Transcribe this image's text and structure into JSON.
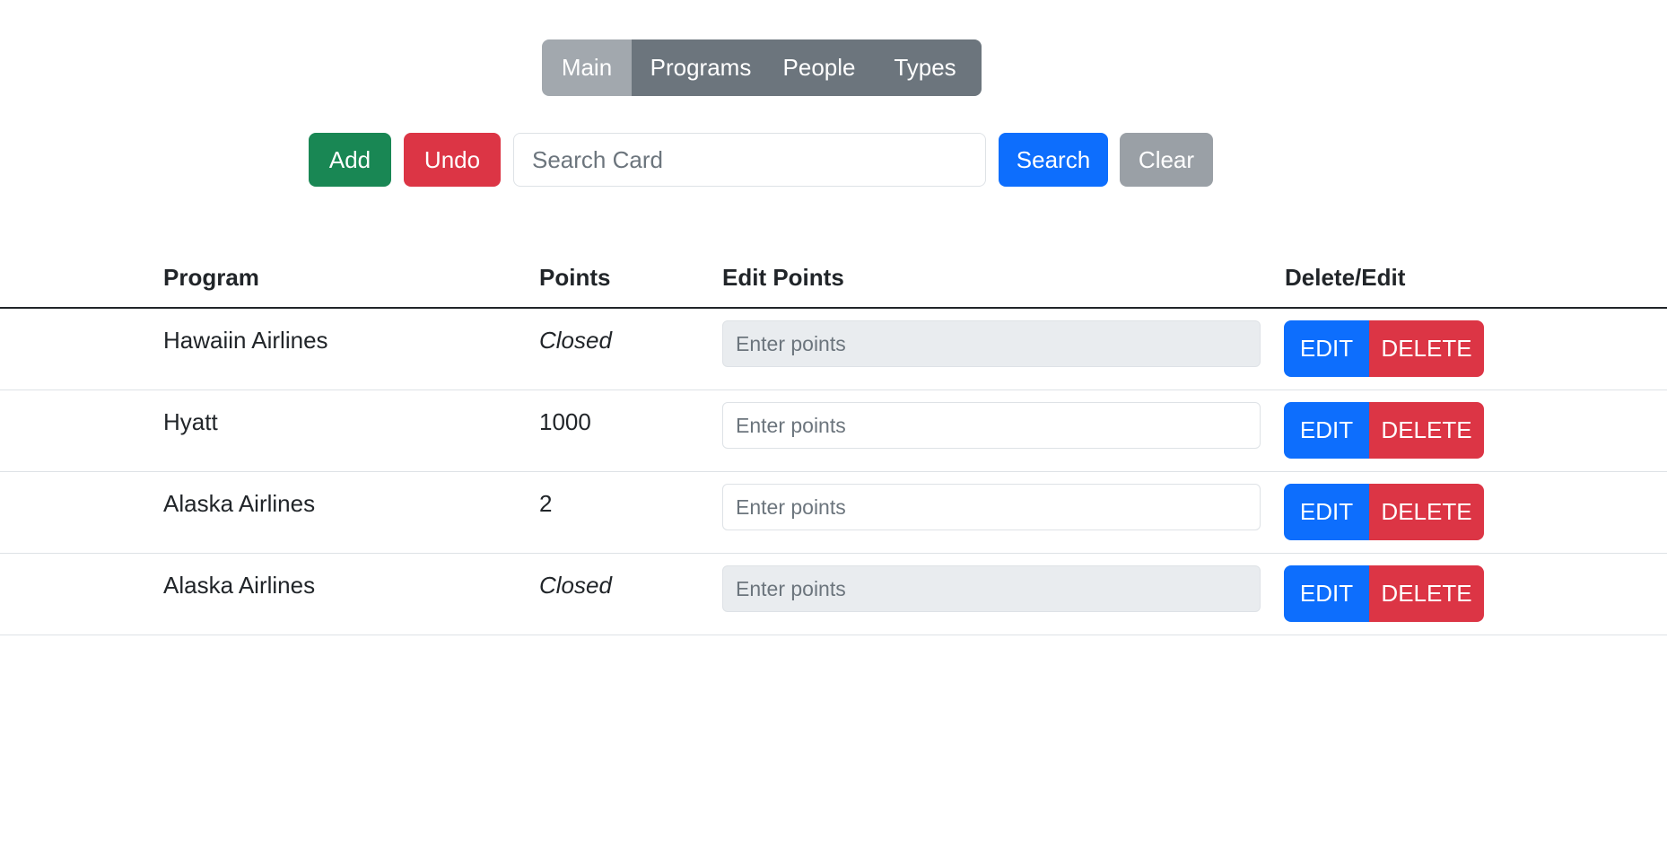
{
  "nav": {
    "tabs": [
      {
        "label": "Main",
        "active": true
      },
      {
        "label": "Programs",
        "active": false
      },
      {
        "label": "People",
        "active": false
      },
      {
        "label": "Types",
        "active": false
      }
    ]
  },
  "toolbar": {
    "add_label": "Add",
    "undo_label": "Undo",
    "search_placeholder": "Search Card",
    "search_value": "",
    "search_label": "Search",
    "clear_label": "Clear"
  },
  "table": {
    "headers": {
      "program": "Program",
      "points": "Points",
      "edit_points": "Edit Points",
      "delete_edit": "Delete/Edit"
    },
    "input_placeholder": "Enter points",
    "edit_label": "EDIT",
    "delete_label": "DELETE",
    "rows": [
      {
        "program": "Hawaiin Airlines",
        "points": "Closed",
        "closed": true
      },
      {
        "program": "Hyatt",
        "points": "1000",
        "closed": false
      },
      {
        "program": "Alaska Airlines",
        "points": "2",
        "closed": false
      },
      {
        "program": "Alaska Airlines",
        "points": "Closed",
        "closed": true
      }
    ]
  },
  "colors": {
    "success": "#198754",
    "danger": "#dc3545",
    "primary": "#0d6efd",
    "secondary": "#6c757d"
  }
}
